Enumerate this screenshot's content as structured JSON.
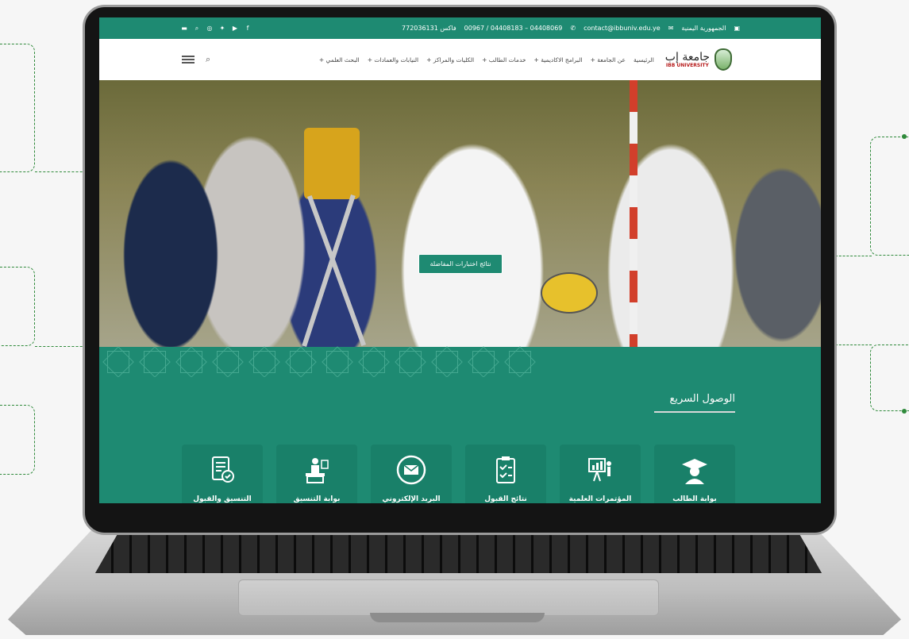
{
  "topbar": {
    "country": "الجمهورية اليمنية",
    "email": "contact@ibbuniv.edu.ye",
    "phones": "00967 / 04408183 – 04408069",
    "fax": "فاكس 772036131"
  },
  "logo": {
    "arabic": "جامعة إب",
    "english": "IBB UNIVERSITY"
  },
  "nav": {
    "items": [
      {
        "label": "الرئيسية"
      },
      {
        "label": "عن الجامعة +"
      },
      {
        "label": "البرامج الاكاديمية +"
      },
      {
        "label": "خدمات الطالب +"
      },
      {
        "label": "الكليات والمراكز +"
      },
      {
        "label": "النيابات والعمادات +"
      },
      {
        "label": "البحث العلمي +"
      }
    ]
  },
  "hero": {
    "button_label": "نتائج اختبارات المفاضلة"
  },
  "quick_access": {
    "title": "الوصول السريع",
    "cards": [
      {
        "label": "بوابة الطالب",
        "icon": "graduate-icon"
      },
      {
        "label": "المؤتمرات العلمية",
        "icon": "presentation-icon"
      },
      {
        "label": "نتائج القبول والمفاضلة",
        "icon": "checklist-icon"
      },
      {
        "label": "البريد الإلكتروني",
        "icon": "mail-icon"
      },
      {
        "label": "بوابة التنسيق الإلكتروني",
        "icon": "desk-icon"
      },
      {
        "label": "التنسيق والقبول",
        "icon": "document-check-icon"
      }
    ]
  },
  "colors": {
    "brand_green": "#1e8a72",
    "circuit_green": "#2f8a3b"
  }
}
